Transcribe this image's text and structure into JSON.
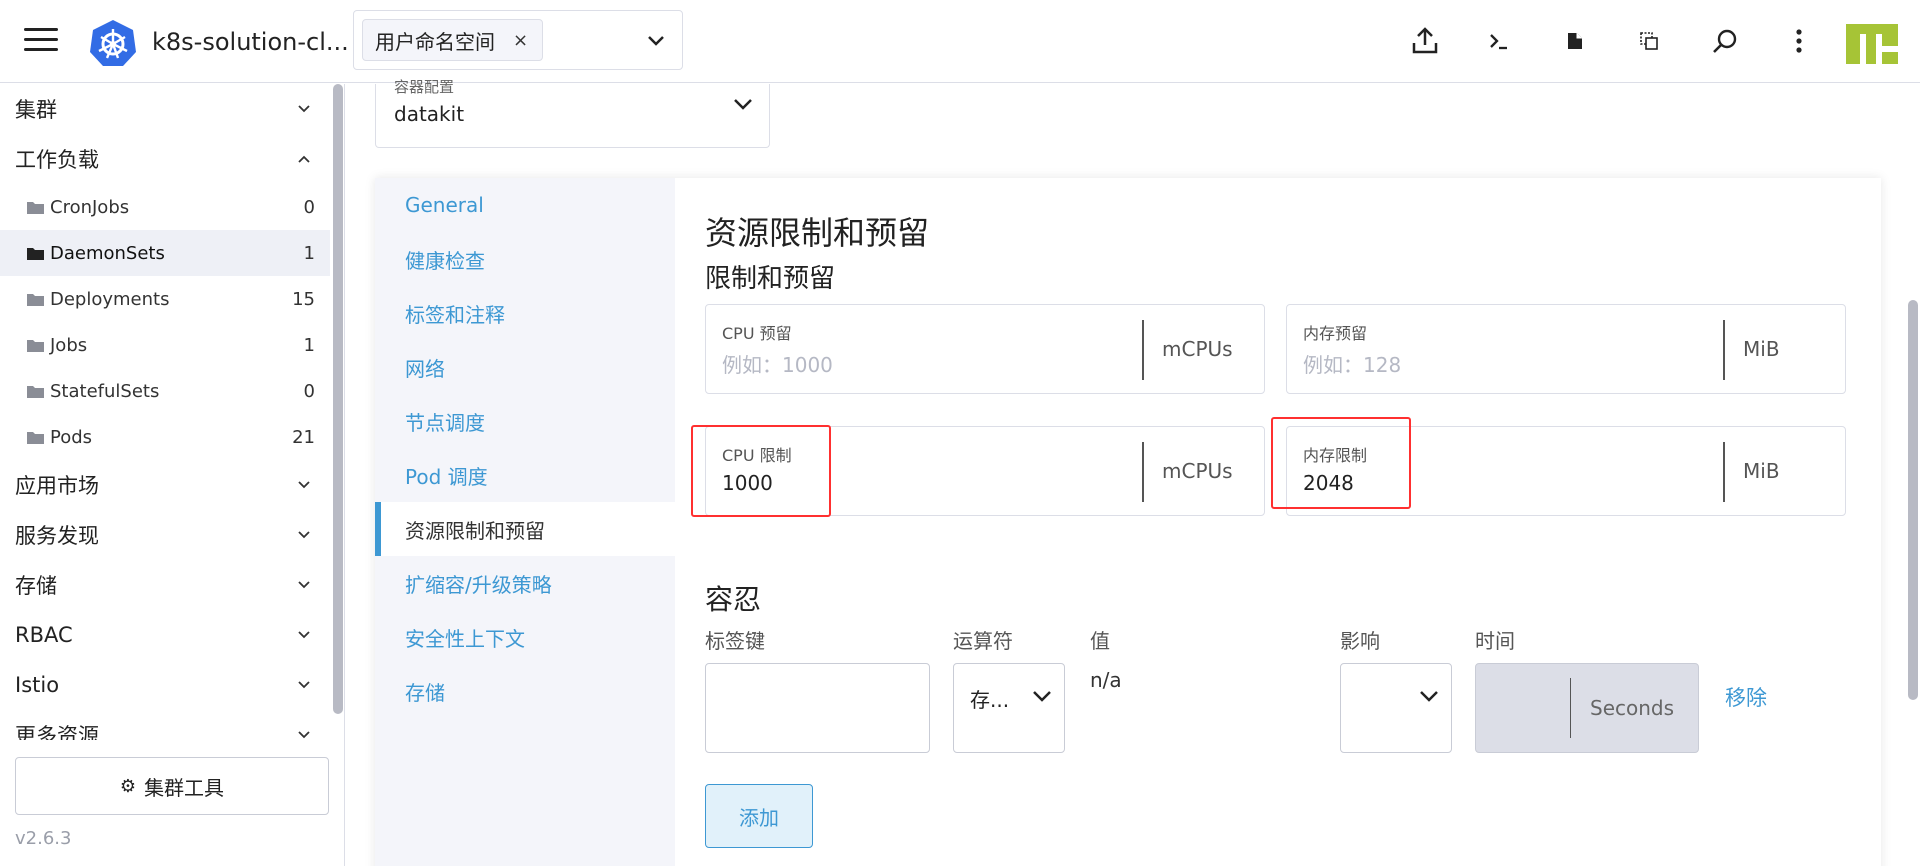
{
  "header": {
    "cluster_name": "k8s-solution-cl...",
    "namespace_chip": "用户命名空间",
    "namespace_chip_close": "×",
    "icons": [
      "menu-icon",
      "kubernetes-logo",
      "upload-icon",
      "terminal-icon",
      "file-icon",
      "copy-icon",
      "search-icon",
      "more-vertical-icon"
    ]
  },
  "sidebar": {
    "groups_top": [
      {
        "label": "集群"
      },
      {
        "label": "工作负载"
      }
    ],
    "workload_items": [
      {
        "label": "CronJobs",
        "count": "0"
      },
      {
        "label": "DaemonSets",
        "count": "1"
      },
      {
        "label": "Deployments",
        "count": "15"
      },
      {
        "label": "Jobs",
        "count": "1"
      },
      {
        "label": "StatefulSets",
        "count": "0"
      },
      {
        "label": "Pods",
        "count": "21"
      }
    ],
    "groups_bottom": [
      {
        "label": "应用市场"
      },
      {
        "label": "服务发现"
      },
      {
        "label": "存储"
      },
      {
        "label": "RBAC"
      },
      {
        "label": "Istio"
      },
      {
        "label": "更多资源"
      }
    ],
    "cluster_tools": "集群工具",
    "version": "v2.6.3"
  },
  "container_config": {
    "label": "容器配置",
    "value": "datakit"
  },
  "tabs": [
    {
      "label": "General"
    },
    {
      "label": "健康检查"
    },
    {
      "label": "标签和注释"
    },
    {
      "label": "网络"
    },
    {
      "label": "节点调度"
    },
    {
      "label": "Pod 调度"
    },
    {
      "label": "资源限制和预留"
    },
    {
      "label": "扩缩容/升级策略"
    },
    {
      "label": "安全性上下文"
    },
    {
      "label": "存储"
    }
  ],
  "resources": {
    "title": "资源限制和预留",
    "subtitle": "限制和预留",
    "cpu_reservation": {
      "label": "CPU 预留",
      "placeholder": "例如：1000",
      "unit": "mCPUs"
    },
    "memory_reservation": {
      "label": "内存预留",
      "placeholder": "例如：128",
      "unit": "MiB"
    },
    "cpu_limit": {
      "label": "CPU 限制",
      "value": "1000",
      "unit": "mCPUs"
    },
    "memory_limit": {
      "label": "内存限制",
      "value": "2048",
      "unit": "MiB"
    }
  },
  "tolerations": {
    "title": "容忍",
    "headers": {
      "key": "标签键",
      "operator": "运算符",
      "value": "值",
      "effect": "影响",
      "time": "时间"
    },
    "row": {
      "key": "",
      "operator": "存...",
      "value": "n/a",
      "effect": "",
      "time_unit": "Seconds",
      "remove": "移除"
    },
    "add_button": "添加"
  },
  "colors": {
    "accent": "#3d98d3",
    "highlight": "#ff3030",
    "brand": "#a6c436"
  }
}
